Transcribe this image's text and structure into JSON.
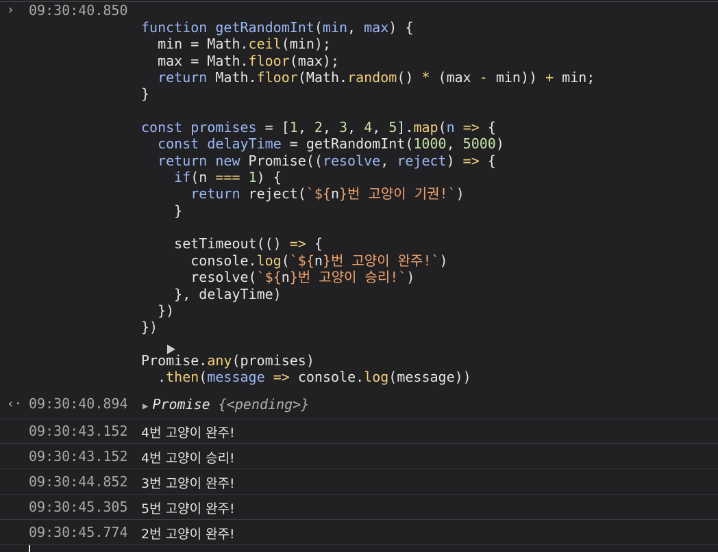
{
  "input": {
    "prompt_icon": "›",
    "timestamp": "09:30:40.850",
    "code_lines": [
      "function getRandomInt(min, max) {",
      "  min = Math.ceil(min);",
      "  max = Math.floor(max);",
      "  return Math.floor(Math.random() * (max - min)) + min;",
      "}",
      "",
      "const promises = [1, 2, 3, 4, 5].map(n => {",
      "  const delayTime = getRandomInt(1000, 5000)",
      "  return new Promise((resolve, reject) => {",
      "    if(n === 1) {",
      "      return reject(`${n}번 고양이 기권!`)",
      "    }",
      "",
      "    setTimeout(() => {",
      "      console.log(`${n}번 고양이 완주!`)",
      "      resolve(`${n}번 고양이 승리!`)",
      "    }, delayTime)",
      "  })",
      "})",
      "",
      "Promise.any(promises)",
      "  .then(message => console.log(message))"
    ]
  },
  "result": {
    "return_icon": "‹·",
    "timestamp": "09:30:40.894",
    "expand_icon": "▶",
    "label": "Promise",
    "state": "{<pending>}"
  },
  "logs": [
    {
      "timestamp": "09:30:43.152",
      "message": "4번 고양이 완주!"
    },
    {
      "timestamp": "09:30:43.152",
      "message": "4번 고양이 승리!"
    },
    {
      "timestamp": "09:30:44.852",
      "message": "3번 고양이 완주!"
    },
    {
      "timestamp": "09:30:45.305",
      "message": "5번 고양이 완주!"
    },
    {
      "timestamp": "09:30:45.774",
      "message": "2번 고양이 완주!"
    }
  ],
  "colors": {
    "background": "#212124",
    "keyword": "#9bb7f4",
    "method": "#f2cf78",
    "number": "#c5e4a4",
    "string": "#f0a36b"
  }
}
